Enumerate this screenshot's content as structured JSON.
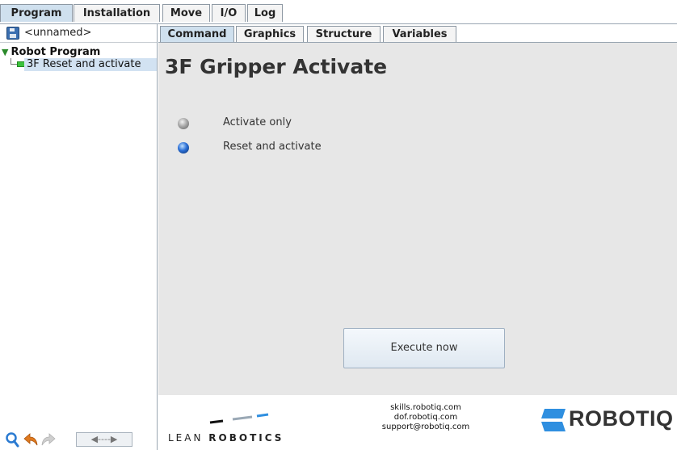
{
  "top_tabs": [
    {
      "label": "Program",
      "active": true
    },
    {
      "label": "Installation",
      "active": false
    },
    {
      "label": "Move",
      "active": false
    },
    {
      "label": "I/O",
      "active": false
    },
    {
      "label": "Log",
      "active": false
    }
  ],
  "sidebar": {
    "file_name": "<unnamed>",
    "tree": {
      "root_label": "Robot Program",
      "nodes": [
        {
          "label": "3F Reset and activate",
          "selected": true
        }
      ]
    },
    "bottom_controls": {
      "icons": [
        "search-icon",
        "undo-icon",
        "redo-icon"
      ],
      "move_control": "◀----▶"
    }
  },
  "sub_tabs": [
    {
      "label": "Command",
      "active": true
    },
    {
      "label": "Graphics",
      "active": false
    },
    {
      "label": "Structure",
      "active": false
    },
    {
      "label": "Variables",
      "active": false
    }
  ],
  "command": {
    "title": "3F Gripper Activate",
    "options": [
      {
        "label": "Activate only",
        "selected": false
      },
      {
        "label": "Reset and activate",
        "selected": true
      }
    ],
    "execute_label": "Execute now"
  },
  "footer": {
    "lean_robotics": {
      "part1": "LEAN ",
      "part2": "ROBOTICS"
    },
    "links": [
      "skills.robotiq.com",
      "dof.robotiq.com",
      "support@robotiq.com"
    ],
    "brand": "ROBOTIQ"
  },
  "colors": {
    "active_tab": "#cfe0ee",
    "selected_node": "#d2e2f2",
    "panel_bg": "#e7e7e7",
    "robotiq_blue": "#2f8fe0",
    "radio_selected": "#2b6fd6"
  }
}
